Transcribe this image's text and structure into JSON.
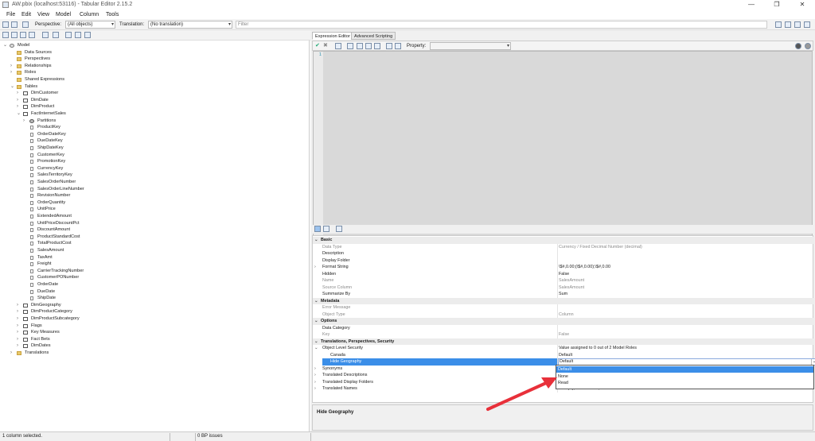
{
  "window": {
    "title": "AW.pbix (localhost:53116) - Tabular Editor 2.15.2"
  },
  "menu": [
    "File",
    "Edit",
    "View",
    "Model",
    "Column",
    "Tools"
  ],
  "toolbar": {
    "perspective_label": "Perspective:",
    "perspective_value": "(All objects)",
    "translation_label": "Translation:",
    "translation_value": "(No translation)",
    "filter_placeholder": "Filter"
  },
  "tree": {
    "model": "Model",
    "top_items": [
      "Data Sources",
      "Perspectives",
      "Relationships",
      "Roles",
      "Shared Expressions",
      "Tables"
    ],
    "tables_before": [
      "DimCustomer",
      "DimDate",
      "DimProduct",
      "FactInternetSales"
    ],
    "partitions": "Partitions",
    "columns": [
      "ProductKey",
      "OrderDateKey",
      "DueDateKey",
      "ShipDateKey",
      "CustomerKey",
      "PromotionKey",
      "CurrencyKey",
      "SalesTerritoryKey",
      "SalesOrderNumber",
      "SalesOrderLineNumber",
      "RevisionNumber",
      "OrderQuantity",
      "UnitPrice",
      "ExtendedAmount",
      "UnitPriceDiscountPct",
      "DiscountAmount",
      "ProductStandardCost",
      "TotalProductCost",
      "SalesAmount",
      "TaxAmt",
      "Freight",
      "CarrierTrackingNumber",
      "CustomerPONumber",
      "OrderDate",
      "DueDate",
      "ShipDate"
    ],
    "tables_after": [
      "DimGeography",
      "DimProductCategory",
      "DimProductSubcategory",
      "Flags",
      "Key Measures",
      "Fact Bets",
      "DimDates"
    ],
    "translations": "Translations"
  },
  "editor": {
    "tabs": [
      "Expression Editor",
      "Advanced Scripting"
    ],
    "property_label": "Property:",
    "line_number": "1"
  },
  "properties": {
    "rows": [
      {
        "type": "cat",
        "name": "Basic"
      },
      {
        "type": "grey",
        "name": "Data Type",
        "value": "Currency / Fixed Decimal Number (decimal)"
      },
      {
        "type": "row",
        "name": "Description",
        "value": ""
      },
      {
        "type": "row",
        "name": "Display Folder",
        "value": ""
      },
      {
        "type": "row",
        "exp": ">",
        "name": "Format String",
        "value": "\\$#,0.00;(\\$#,0.00);\\$#,0.00"
      },
      {
        "type": "row",
        "name": "Hidden",
        "value": "False"
      },
      {
        "type": "grey",
        "name": "Name",
        "value": "SalesAmount"
      },
      {
        "type": "grey",
        "name": "Source Column",
        "value": "SalesAmount"
      },
      {
        "type": "row",
        "name": "Summarize By",
        "value": "Sum"
      },
      {
        "type": "cat",
        "name": "Metadata"
      },
      {
        "type": "grey",
        "name": "Error Message",
        "value": ""
      },
      {
        "type": "grey",
        "name": "Object Type",
        "value": "Column"
      },
      {
        "type": "cat",
        "name": "Options"
      },
      {
        "type": "row",
        "name": "Data Category",
        "value": ""
      },
      {
        "type": "grey",
        "name": "Key",
        "value": "False"
      },
      {
        "type": "cat",
        "name": "Translations, Perspectives, Security"
      },
      {
        "type": "row",
        "exp": "v",
        "name": "Object Level Security",
        "value": "Value assigned to 0 out of 2 Model Roles"
      },
      {
        "type": "indent",
        "name": "Canada",
        "value": "Default"
      },
      {
        "type": "sel",
        "name": "Hide Geography",
        "value": "Default"
      },
      {
        "type": "row",
        "exp": ">",
        "name": "Synonyms",
        "value": ""
      },
      {
        "type": "row",
        "exp": ">",
        "name": "Translated Descriptions",
        "value": ""
      },
      {
        "type": "row",
        "exp": ">",
        "name": "Translated Display Folders",
        "value": ""
      },
      {
        "type": "row",
        "exp": ">",
        "name": "Translated Names",
        "value": "1 empty, 0 translated, 0 default"
      }
    ],
    "dropdown_options": [
      "Default",
      "None",
      "Read"
    ],
    "dropdown_selected": "Default",
    "description_title": "Hide Geography"
  },
  "status": {
    "selection": "1 column selected.",
    "bp_issues": "0 BP issues"
  },
  "colors": {
    "accent": "#3b8ee8",
    "arrow": "#e8303a"
  }
}
